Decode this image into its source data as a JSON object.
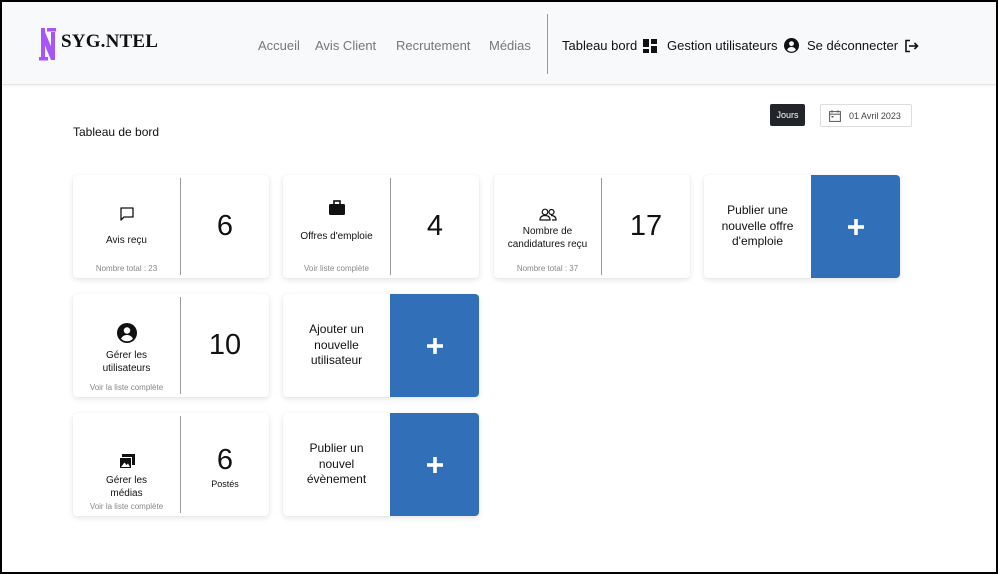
{
  "brand": {
    "logo_text": "SYG.NTEL",
    "logo_letter": "N",
    "accent": "#a855f7"
  },
  "nav": {
    "links": [
      {
        "label": "Accueil"
      },
      {
        "label": "Avis Client"
      },
      {
        "label": "Recrutement"
      },
      {
        "label": "Médias"
      }
    ],
    "right": [
      {
        "label": "Tableau bord",
        "icon": "dashboard-icon"
      },
      {
        "label": "Gestion utilisateurs",
        "icon": "user-circle-icon"
      },
      {
        "label": "Se déconnecter",
        "icon": "logout-icon"
      }
    ]
  },
  "page": {
    "title": "Tableau de bord",
    "period_button": "Jours",
    "date_label": "01 Avril 2023"
  },
  "stats": [
    {
      "label": "Avis reçu",
      "value": "6",
      "sub": "Nombre total : 23",
      "icon": "chat-icon"
    },
    {
      "label": "Offres d'emploie",
      "value": "4",
      "sub": "Voir liste complète",
      "icon": "briefcase-icon"
    },
    {
      "label": "Nombre de candidatures reçu",
      "value": "17",
      "sub": "Nombre total : 37",
      "icon": "people-icon"
    },
    {
      "label": "Gérer les utilisateurs",
      "value": "10",
      "sub": "Voir la liste complète",
      "icon": "user-circle-icon"
    },
    {
      "label": "Gérer les médias",
      "value": "6",
      "value_caption": "Postés",
      "sub": "Voir la liste complète",
      "icon": "images-icon"
    }
  ],
  "actions": [
    {
      "label": "Publier une nouvelle offre d'emploie",
      "button": "+"
    },
    {
      "label": "Ajouter un nouvelle utilisateur",
      "button": "+"
    },
    {
      "label": "Publier un nouvel évènement",
      "button": "+"
    }
  ],
  "colors": {
    "primary": "#3170b8",
    "dark_button": "#212529",
    "navbar_bg": "#f8f9fa"
  }
}
